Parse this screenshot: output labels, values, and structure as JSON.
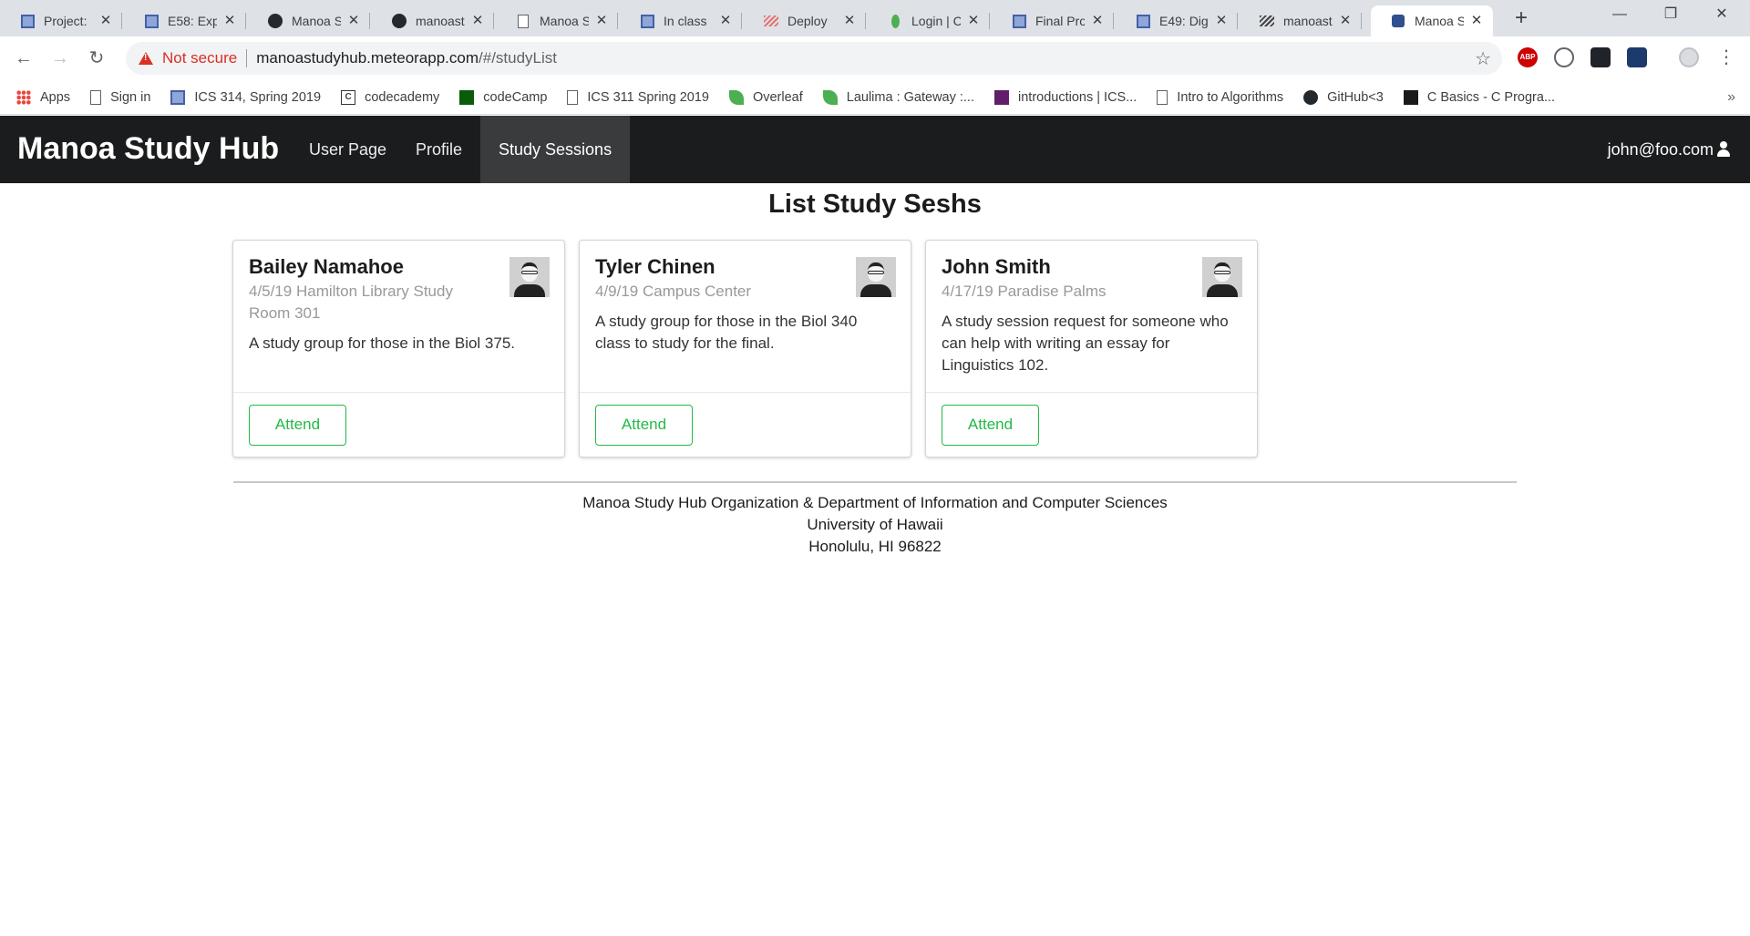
{
  "browser": {
    "tabs": [
      {
        "title": "Project: ",
        "icon": "blue-square-icon"
      },
      {
        "title": "E58: Exp",
        "icon": "blue-square-icon"
      },
      {
        "title": "Manoa S",
        "icon": "github-icon"
      },
      {
        "title": "manoast",
        "icon": "github-icon"
      },
      {
        "title": "Manoa S",
        "icon": "document-icon"
      },
      {
        "title": "In class ",
        "icon": "blue-square-icon"
      },
      {
        "title": "Deploy ",
        "icon": "meteor-red-icon"
      },
      {
        "title": "Login | C",
        "icon": "leaf-icon"
      },
      {
        "title": "Final Pro",
        "icon": "blue-square-icon"
      },
      {
        "title": "E49: Dig",
        "icon": "blue-square-icon"
      },
      {
        "title": "manoast",
        "icon": "meteor-dark-icon"
      },
      {
        "title": "Manoa S",
        "icon": "meteor-icon",
        "active": true
      }
    ],
    "address": {
      "security_label": "Not secure",
      "host": "manoastudyhub.meteorapp.com",
      "path": "/#/studyList"
    },
    "bookmarks": [
      {
        "label": "Apps",
        "icon": "apps-grid-icon"
      },
      {
        "label": "Sign in",
        "icon": "document-icon"
      },
      {
        "label": "ICS 314, Spring 2019",
        "icon": "blue-square-icon"
      },
      {
        "label": "codecademy",
        "icon": "codecademy-icon"
      },
      {
        "label": "codeCamp",
        "icon": "codecamp-icon"
      },
      {
        "label": "ICS 311 Spring 2019",
        "icon": "document-icon"
      },
      {
        "label": "Overleaf",
        "icon": "overleaf-icon"
      },
      {
        "label": "Laulima : Gateway :...",
        "icon": "leaf-icon"
      },
      {
        "label": "introductions | ICS...",
        "icon": "slack-icon"
      },
      {
        "label": "Intro to Algorithms",
        "icon": "document-icon"
      },
      {
        "label": "GitHub<3",
        "icon": "github-icon"
      },
      {
        "label": "C Basics - C Progra...",
        "icon": "terminal-icon"
      }
    ],
    "extensions": {
      "abp_label": "ABP"
    }
  },
  "app": {
    "brand": "Manoa Study Hub",
    "nav": [
      "User Page",
      "Profile",
      "Study Sessions"
    ],
    "active_nav": "Study Sessions",
    "user": "john@foo.com"
  },
  "page": {
    "title": "List Study Seshs",
    "cards": [
      {
        "name": "Bailey Namahoe",
        "meta": "4/5/19 Hamilton Library Study Room 301",
        "description": "A study group for those in the Biol 375.",
        "button": "Attend"
      },
      {
        "name": "Tyler Chinen",
        "meta": "4/9/19 Campus Center",
        "description": "A study group for those in the Biol 340 class to study for the final.",
        "button": "Attend"
      },
      {
        "name": "John Smith",
        "meta": "4/17/19 Paradise Palms",
        "description": "A study session request for someone who can help with writing an essay for Linguistics 102.",
        "button": "Attend"
      }
    ],
    "footer": [
      "Manoa Study Hub Organization & Department of Information and Computer Sciences",
      "University of Hawaii",
      "Honolulu, HI 96822"
    ]
  },
  "colors": {
    "navbar": "#1b1c1d",
    "nav_active": "#3a3b3c",
    "attend_green": "#21ba45",
    "not_secure_red": "#d93025"
  }
}
